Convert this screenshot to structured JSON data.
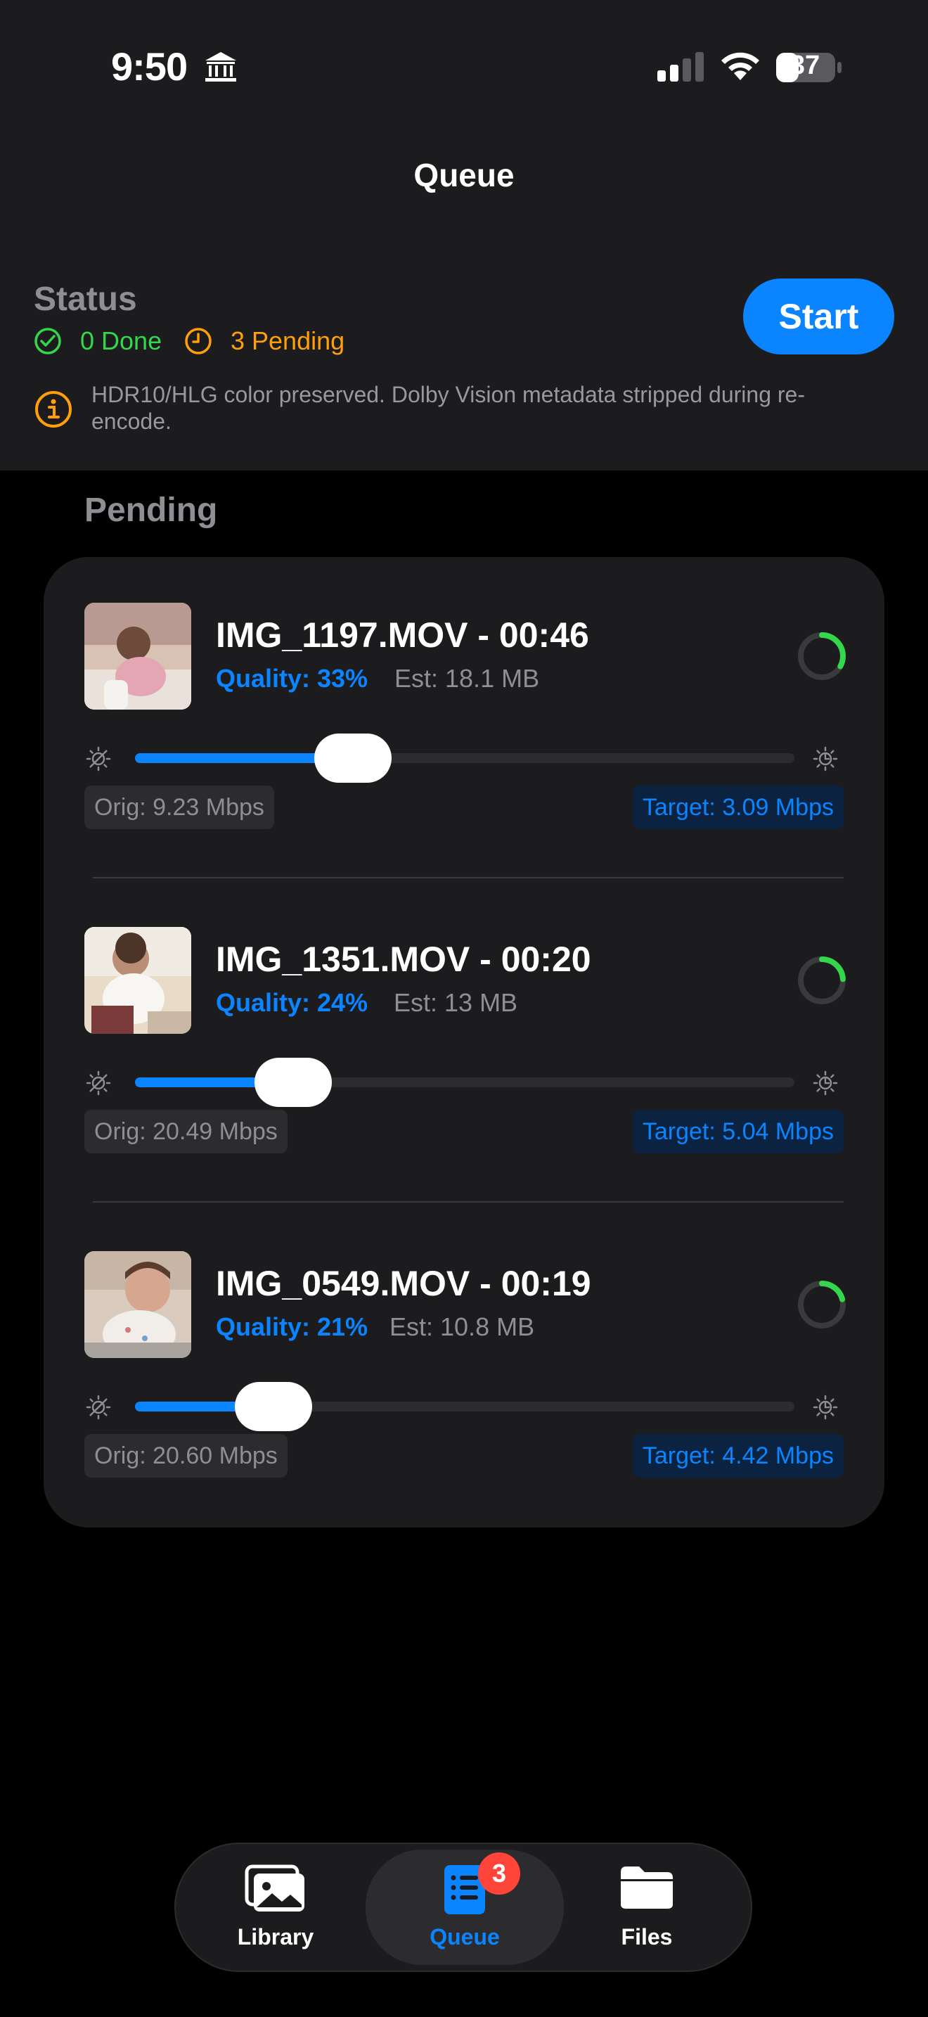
{
  "status_bar": {
    "time": "9:50",
    "battery": "37"
  },
  "nav": {
    "title": "Queue"
  },
  "status": {
    "title": "Status",
    "done_label": "0 Done",
    "pending_label": "3 Pending",
    "start_label": "Start",
    "info_text": "HDR10/HLG color preserved. Dolby Vision metadata stripped during re-encode."
  },
  "colors": {
    "accent": "#0a84ff",
    "done": "#32d74b",
    "pending": "#ff9f0a",
    "badge": "#ff453a"
  },
  "pending": {
    "header": "Pending",
    "items": [
      {
        "name": "IMG_1197.MOV - 00:46",
        "quality": "Quality: 33%",
        "est": "Est: 18.1 MB",
        "orig": "Orig: 9.23 Mbps",
        "target": "Target: 3.09 Mbps",
        "slider": 0.33,
        "progress": 0.33
      },
      {
        "name": "IMG_1351.MOV - 00:20",
        "quality": "Quality: 24%",
        "est": "Est: 13 MB",
        "orig": "Orig: 20.49 Mbps",
        "target": "Target: 5.04 Mbps",
        "slider": 0.24,
        "progress": 0.24
      },
      {
        "name": "IMG_0549.MOV - 00:19",
        "quality": "Quality: 21%",
        "est": "Est: 10.8 MB",
        "orig": "Orig: 20.60 Mbps",
        "target": "Target: 4.42 Mbps",
        "slider": 0.21,
        "progress": 0.21
      }
    ]
  },
  "tabbar": {
    "library_label": "Library",
    "queue_label": "Queue",
    "queue_badge": "3",
    "files_label": "Files",
    "active": "queue"
  }
}
